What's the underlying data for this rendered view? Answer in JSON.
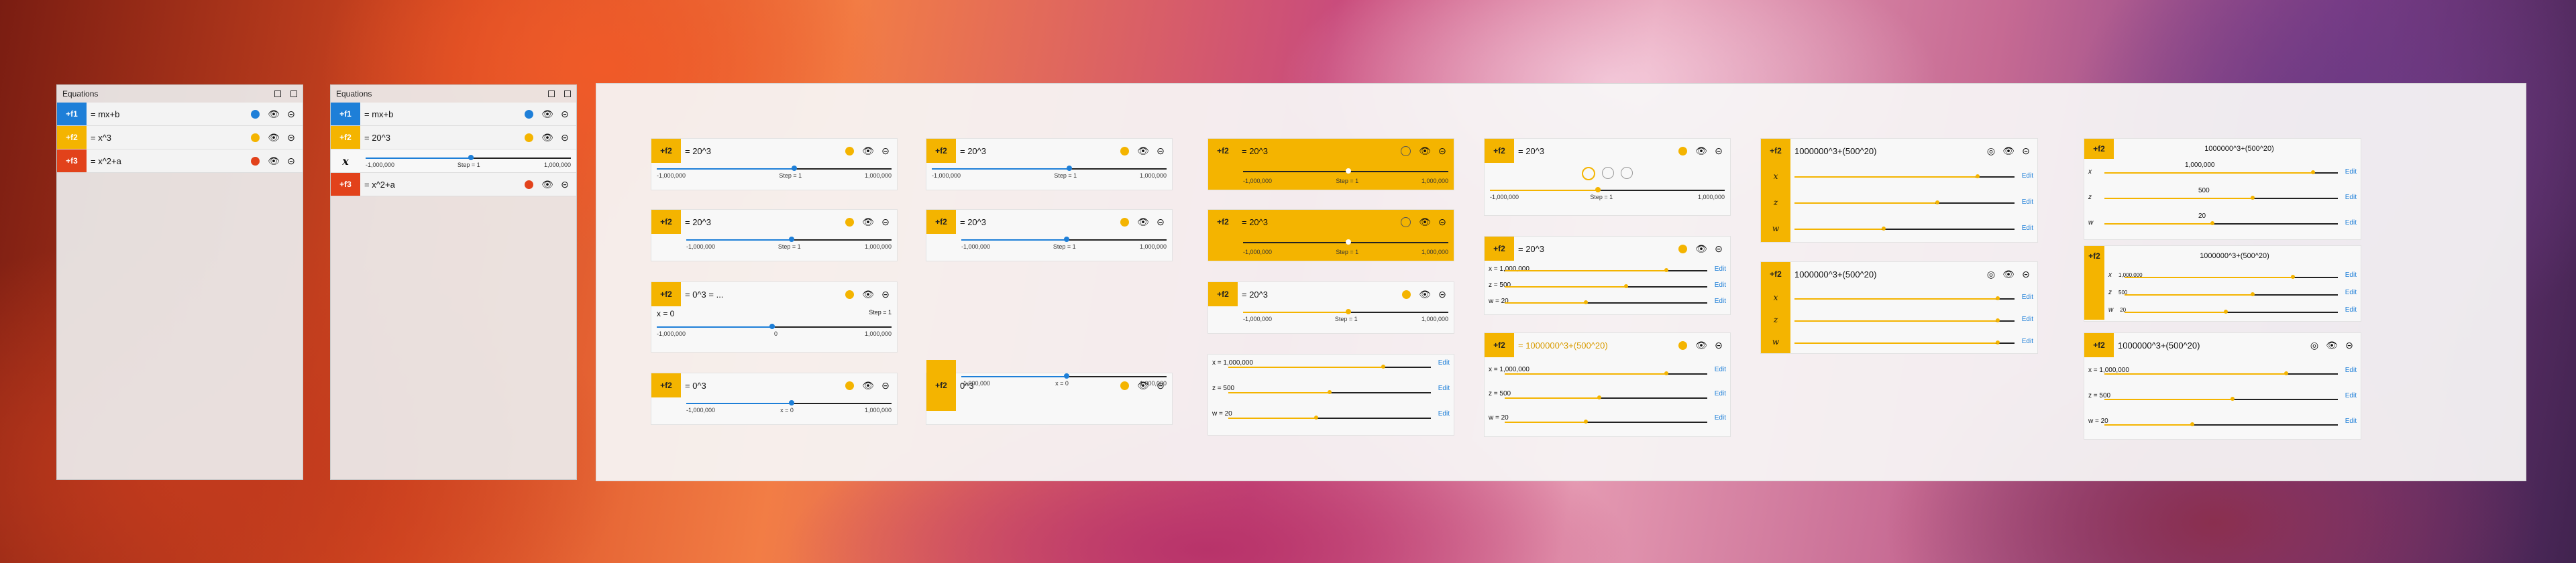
{
  "window_title": "Equations",
  "left_panel": {
    "rows": [
      {
        "label": "f1",
        "expr": "= mx+b",
        "color": "#1e7fd8",
        "dot": "#1e7fd8"
      },
      {
        "label": "f2",
        "expr": "= x^3",
        "color": "#f4b400",
        "dot": "#f4b400"
      },
      {
        "label": "f3",
        "expr": "= x^2+a",
        "color": "#e2421b",
        "dot": "#e2421b"
      }
    ]
  },
  "mid_panel": {
    "rows": [
      {
        "label": "f1",
        "expr": "= mx+b",
        "color": "#1e7fd8",
        "dot": "#1e7fd8"
      },
      {
        "label": "f2",
        "expr": "= 20^3",
        "color": "#f4b400",
        "dot": "#f4b400"
      },
      {
        "label": "f3",
        "expr": "= x^2+a",
        "color": "#e2421b",
        "dot": "#e2421b"
      }
    ],
    "slider": {
      "var": "x",
      "min": "-1,000,000",
      "max": "1,000,000",
      "step": "Step = 1",
      "level": 0.5
    }
  },
  "cards": {
    "c1": {
      "label": "f2",
      "expr": "= 20^3",
      "min": "-1,000,000",
      "mid": "Step = 1",
      "max": "1,000,000"
    },
    "c2": {
      "label": "f2",
      "expr": "= 20^3",
      "min": "-1,000,000",
      "mid": "Step = 1",
      "max": "1,000,000"
    },
    "c3": {
      "label": "f2",
      "expr": "= 0^3 = ...",
      "var": "x = 0",
      "min": "-1,000,000",
      "mid": "0",
      "max": "1,000,000",
      "step": "Step = 1"
    },
    "c4": {
      "label": "f2",
      "expr": "= 0^3",
      "min": "-1,000,000",
      "mid": "x = 0",
      "max": "1,000,000"
    },
    "c5": {
      "label": "f2",
      "expr": "= 20^3",
      "min": "-1,000,000",
      "mid": "Step = 1",
      "max": "1,000,000"
    },
    "c6": {
      "label": "f2",
      "expr": "= 20^3",
      "min": "-1,000,000",
      "mid": "Step = 1",
      "max": "1,000,000"
    },
    "c7": {
      "label": "f2",
      "expr": "0^3",
      "min": "-1,000,000",
      "mid": "x = 0",
      "max": "1,000,000"
    },
    "c8": {
      "label": "f2",
      "expr": "= 20^3",
      "min": "-1,000,000",
      "mid": "Step = 1",
      "max": "1,000,000"
    },
    "c9": {
      "label": "f2",
      "expr": "= 20^3",
      "min": "-1,000,000",
      "mid": "Step = 1",
      "max": "1,000,000"
    },
    "c10": {
      "label": "f2",
      "expr": "= 20^3",
      "min": "-1,000,000",
      "mid": "Step = 1",
      "max": "1,000,000"
    },
    "c11": {
      "rows": [
        {
          "v": "x = 1,000,000"
        },
        {
          "v": "z = 500"
        },
        {
          "v": "w = 20"
        }
      ],
      "edit": "Edit"
    },
    "c12": {
      "label": "f2",
      "expr": "= 20^3",
      "min": "-1,000,000",
      "mid": "Step = 1",
      "max": "1,000,000"
    },
    "c13": {
      "label": "f2",
      "expr": "= 20^3",
      "rows": [
        {
          "v": "x = 1,000,000"
        },
        {
          "v": "z = 500"
        },
        {
          "v": "w = 20"
        }
      ],
      "edit": "Edit"
    },
    "c14": {
      "label": "f2",
      "expr": "= 1000000^3+(500^20)",
      "rows": [
        {
          "v": "x = 1,000,000"
        },
        {
          "v": "z = 500"
        },
        {
          "v": "w = 20"
        }
      ],
      "edit": "Edit"
    },
    "c15": {
      "label": "f2",
      "expr": "1000000^3+(500^20)",
      "rows": [
        {
          "v": "x"
        },
        {
          "v": "z"
        },
        {
          "v": "w"
        }
      ],
      "edit": "Edit"
    },
    "c16": {
      "label": "f2",
      "expr": "1000000^3+(500^20)",
      "rows": [
        {
          "v": "x"
        },
        {
          "v": "z"
        },
        {
          "v": "w"
        }
      ],
      "edit": "Edit"
    },
    "c17": {
      "label": "f2",
      "expr": "1000000^3+(500^20)",
      "rows": [
        {
          "v": "x",
          "val": "1,000,000"
        },
        {
          "v": "z",
          "val": "500"
        },
        {
          "v": "w",
          "val": "20"
        }
      ],
      "edit": "Edit"
    },
    "c18": {
      "label": "f2",
      "expr": "1000000^3+(500^20)",
      "rows": [
        {
          "v": "x",
          "val": "1,000,000"
        },
        {
          "v": "z",
          "val": "500"
        },
        {
          "v": "w",
          "val": "20"
        }
      ],
      "edit": "Edit"
    },
    "c19": {
      "label": "f2",
      "expr": "1000000^3+(500^20)",
      "rows": [
        {
          "v": "x = 1,000,000"
        },
        {
          "v": "z = 500"
        },
        {
          "v": "w = 20"
        }
      ],
      "edit": "Edit"
    }
  }
}
